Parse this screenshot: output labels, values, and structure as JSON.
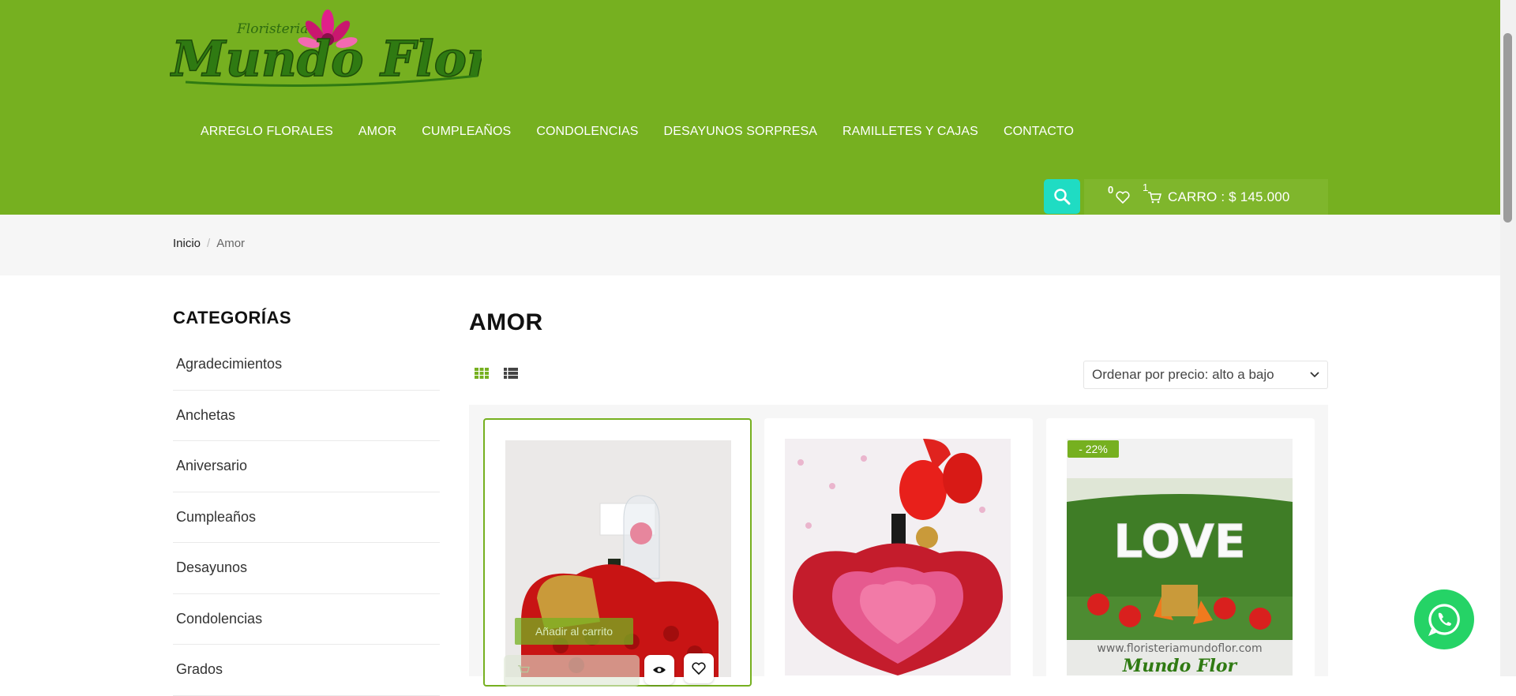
{
  "brand": {
    "subtitle": "Floristeria",
    "name": "Mundo Flor",
    "colors": {
      "header_green": "#76b020",
      "accent_teal": "#1fdcc3",
      "whatsapp": "#25d366"
    }
  },
  "nav": {
    "items": [
      {
        "label": "ARREGLO FLORALES"
      },
      {
        "label": "AMOR"
      },
      {
        "label": "CUMPLEAÑOS"
      },
      {
        "label": "CONDOLENCIAS"
      },
      {
        "label": "DESAYUNOS SORPRESA"
      },
      {
        "label": "RAMILLETES Y CAJAS"
      },
      {
        "label": "CONTACTO"
      }
    ]
  },
  "header_actions": {
    "search_icon": "search-icon",
    "wishlist_count": "0",
    "cart_count": "1",
    "cart_label": "CARRO : $ 145.000"
  },
  "breadcrumb": {
    "home": "Inicio",
    "separator": "/",
    "current": "Amor"
  },
  "sidebar": {
    "title": "CATEGORÍAS",
    "items": [
      {
        "label": "Agradecimientos"
      },
      {
        "label": "Anchetas"
      },
      {
        "label": "Aniversario"
      },
      {
        "label": "Cumpleaños"
      },
      {
        "label": "Desayunos"
      },
      {
        "label": "Condolencias"
      },
      {
        "label": "Grados"
      }
    ]
  },
  "main": {
    "title": "AMOR",
    "sort": {
      "selected": "Ordenar por precio: alto a bajo"
    },
    "products": [
      {
        "add_to_cart": "Añadir al carrito"
      },
      {},
      {
        "badge": "- 22%",
        "image_text_url": "www.floristeriamundoflor.com",
        "image_text_logo": "Mundo Flor",
        "image_text_word": "LOVE"
      }
    ]
  }
}
